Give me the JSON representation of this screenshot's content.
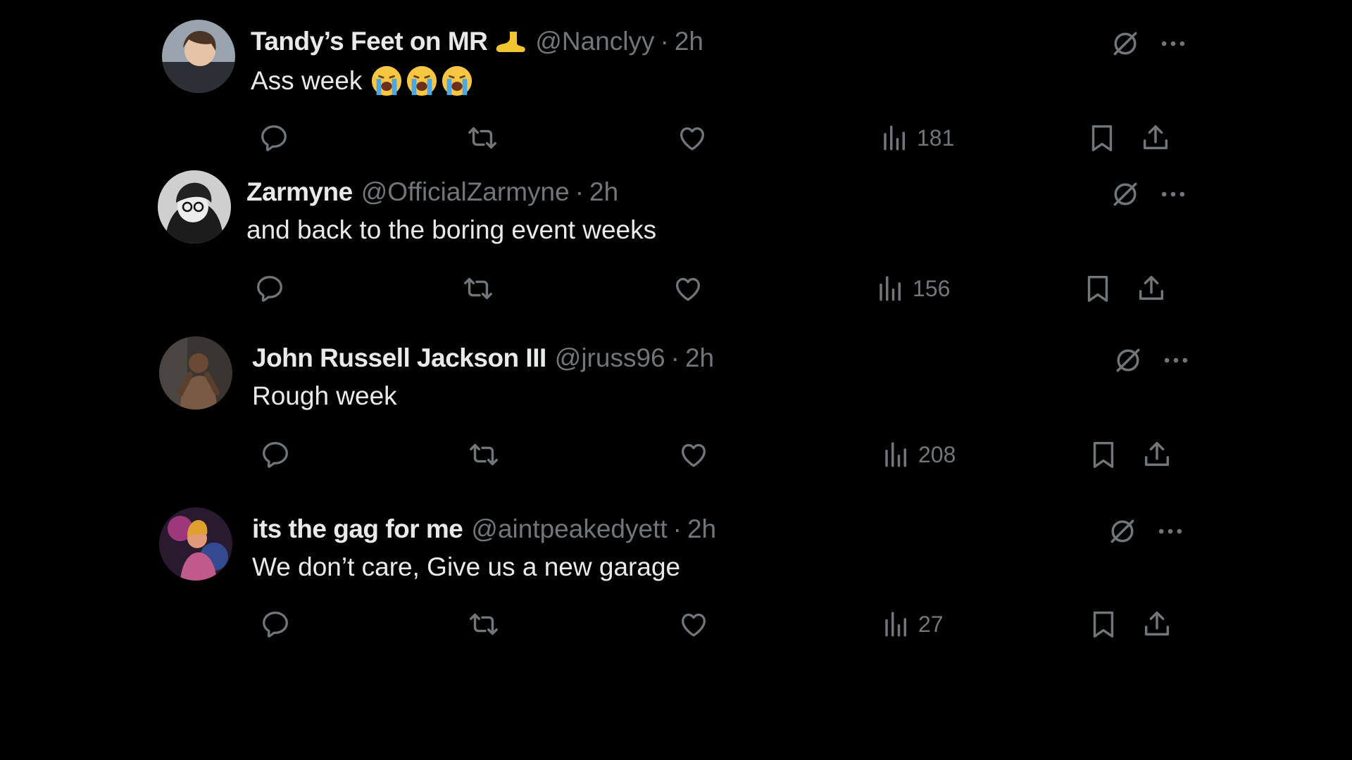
{
  "colors": {
    "background": "#000000",
    "text_primary": "#e7e9ea",
    "text_secondary": "#71767b"
  },
  "icons": {
    "grok": "grok-icon",
    "more": "more-icon",
    "reply": "reply-icon",
    "retweet": "retweet-icon",
    "like": "heart-icon",
    "views": "views-icon",
    "bookmark": "bookmark-icon",
    "share": "share-icon"
  },
  "tweets": [
    {
      "name": "Tandy’s Feet on MR",
      "name_emoji": "foot-emoji",
      "handle": "@Nanclyy",
      "separator": "·",
      "time": "2h",
      "text": "Ass week",
      "text_emojis": [
        "loudly-crying-face",
        "loudly-crying-face",
        "loudly-crying-face"
      ],
      "views": "181"
    },
    {
      "name": "Zarmyne",
      "handle": "@OfficialZarmyne",
      "separator": "·",
      "time": "2h",
      "text": "and back to the boring event weeks",
      "views": "156"
    },
    {
      "name": "John Russell Jackson III",
      "handle": "@jruss96",
      "separator": "·",
      "time": "2h",
      "text": "Rough week",
      "views": "208"
    },
    {
      "name": "its the gag for me",
      "handle": "@aintpeakedyett",
      "separator": "·",
      "time": "2h",
      "text": "We don’t care, Give us a new garage",
      "views": "27"
    }
  ]
}
